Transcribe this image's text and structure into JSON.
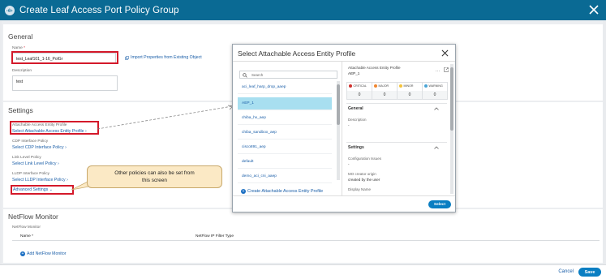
{
  "header": {
    "title": "Create Leaf Access Port Policy Group"
  },
  "general": {
    "title": "General",
    "name_label": "Name",
    "name_value": "test_Leaf101_1-16_PolGr",
    "import_link": "Import Properties from Existing Object",
    "description_label": "Description",
    "description_value": "test"
  },
  "settings": {
    "title": "Settings",
    "aaep_label": "Attachable Access Entity Profile",
    "aaep_link": "Select Attachable Access Entity Profile",
    "cdp_label": "CDP Interface Policy",
    "cdp_link": "Select CDP Interface Policy",
    "link_label": "Link Level Policy",
    "link_link": "Select Link Level Policy",
    "lldp_label": "LLDP Interface Policy",
    "lldp_link": "Select LLDP Interface Policy",
    "advanced_link": "Advanced Settings"
  },
  "callout": {
    "text": "Other policies can also be set from this screen"
  },
  "netflow": {
    "title": "NetFlow Monitor",
    "sub_label": "NetFlow Monitor",
    "col_name": "Name",
    "col_filter": "NetFlow IP Filter Type",
    "add_link": "Add NetFlow Monitor"
  },
  "footer": {
    "cancel": "Cancel",
    "save": "Save"
  },
  "modal": {
    "title": "Select Attachable Access Entity Profile",
    "search_placeholder": "Search",
    "items": [
      "aci_leaf_harp_drop_aaep",
      "AEP_1",
      "chiba_hx_aep",
      "chiba_sandbox_aep",
      "cisco891_aep",
      "default",
      "demo_aci_cni_aaep"
    ],
    "create_link": "Create Attachable Access Entity Profile",
    "select_button": "Select",
    "detail": {
      "title": "Attachable Access Entity Profile",
      "name": "AEP_1",
      "faults": [
        {
          "label": "CRITICAL",
          "value": "0",
          "color": "#d0312d"
        },
        {
          "label": "MAJOR",
          "value": "0",
          "color": "#f0862f"
        },
        {
          "label": "MINOR",
          "value": "0",
          "color": "#f5c33a"
        },
        {
          "label": "WARNING",
          "value": "0",
          "color": "#4aa5d6"
        }
      ],
      "general_label": "General",
      "description_label": "Description",
      "description_value": "-",
      "settings_label": "Settings",
      "config_issues_label": "Configuration Issues",
      "config_issues_value": "-",
      "mo_creator_label": "MO creator origin",
      "mo_creator_value": "created by the user",
      "display_name_label": "Display Name"
    }
  }
}
